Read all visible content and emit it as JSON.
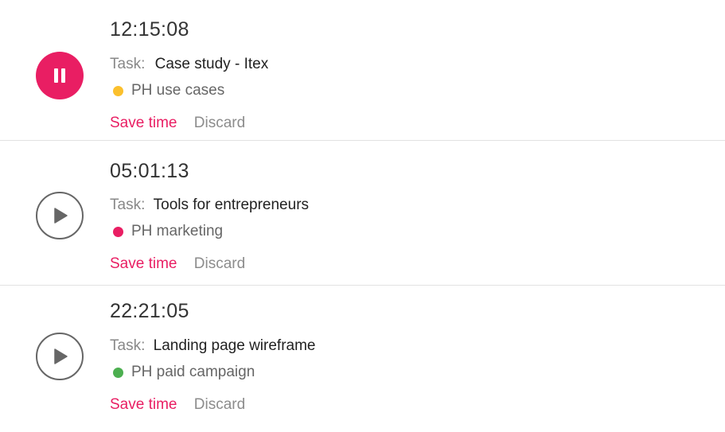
{
  "timers": [
    {
      "time": "12:15:08",
      "state": "running",
      "control_icon": "pause-icon",
      "task_prefix": "Task:",
      "task_name": "Case study - Itex",
      "project": "PH use cases",
      "project_color": "#fbc02d",
      "save_label": "Save time",
      "discard_label": "Discard"
    },
    {
      "time": "05:01:13",
      "state": "paused",
      "control_icon": "play-icon",
      "task_prefix": "Task:",
      "task_name": "Tools for entrepreneurs",
      "project": "PH marketing",
      "project_color": "#e91e63",
      "save_label": "Save time",
      "discard_label": "Discard"
    },
    {
      "time": "22:21:05",
      "state": "paused",
      "control_icon": "play-icon",
      "task_prefix": "Task:",
      "task_name": "Landing page wireframe",
      "project": "PH paid campaign",
      "project_color": "#4caf50",
      "save_label": "Save time",
      "discard_label": "Discard"
    }
  ],
  "colors": {
    "accent": "#e91e63",
    "muted": "#8c8c8c",
    "divider": "#e2e2e2"
  }
}
